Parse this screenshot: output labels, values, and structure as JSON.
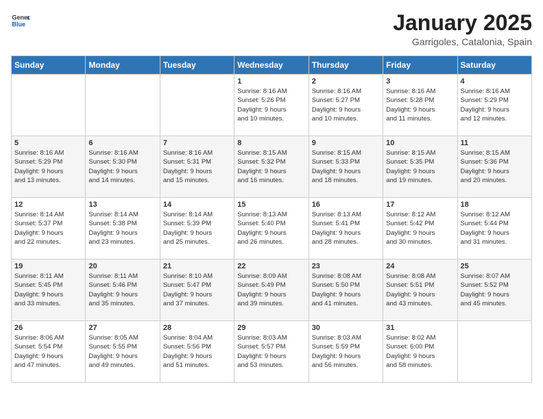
{
  "header": {
    "logo_general": "General",
    "logo_blue": "Blue",
    "month": "January 2025",
    "location": "Garrigoles, Catalonia, Spain"
  },
  "weekdays": [
    "Sunday",
    "Monday",
    "Tuesday",
    "Wednesday",
    "Thursday",
    "Friday",
    "Saturday"
  ],
  "weeks": [
    [
      {
        "day": "",
        "info": ""
      },
      {
        "day": "",
        "info": ""
      },
      {
        "day": "",
        "info": ""
      },
      {
        "day": "1",
        "info": "Sunrise: 8:16 AM\nSunset: 5:26 PM\nDaylight: 9 hours\nand 10 minutes."
      },
      {
        "day": "2",
        "info": "Sunrise: 8:16 AM\nSunset: 5:27 PM\nDaylight: 9 hours\nand 10 minutes."
      },
      {
        "day": "3",
        "info": "Sunrise: 8:16 AM\nSunset: 5:28 PM\nDaylight: 9 hours\nand 11 minutes."
      },
      {
        "day": "4",
        "info": "Sunrise: 8:16 AM\nSunset: 5:29 PM\nDaylight: 9 hours\nand 12 minutes."
      }
    ],
    [
      {
        "day": "5",
        "info": "Sunrise: 8:16 AM\nSunset: 5:29 PM\nDaylight: 9 hours\nand 13 minutes."
      },
      {
        "day": "6",
        "info": "Sunrise: 8:16 AM\nSunset: 5:30 PM\nDaylight: 9 hours\nand 14 minutes."
      },
      {
        "day": "7",
        "info": "Sunrise: 8:16 AM\nSunset: 5:31 PM\nDaylight: 9 hours\nand 15 minutes."
      },
      {
        "day": "8",
        "info": "Sunrise: 8:15 AM\nSunset: 5:32 PM\nDaylight: 9 hours\nand 16 minutes."
      },
      {
        "day": "9",
        "info": "Sunrise: 8:15 AM\nSunset: 5:33 PM\nDaylight: 9 hours\nand 18 minutes."
      },
      {
        "day": "10",
        "info": "Sunrise: 8:15 AM\nSunset: 5:35 PM\nDaylight: 9 hours\nand 19 minutes."
      },
      {
        "day": "11",
        "info": "Sunrise: 8:15 AM\nSunset: 5:36 PM\nDaylight: 9 hours\nand 20 minutes."
      }
    ],
    [
      {
        "day": "12",
        "info": "Sunrise: 8:14 AM\nSunset: 5:37 PM\nDaylight: 9 hours\nand 22 minutes."
      },
      {
        "day": "13",
        "info": "Sunrise: 8:14 AM\nSunset: 5:38 PM\nDaylight: 9 hours\nand 23 minutes."
      },
      {
        "day": "14",
        "info": "Sunrise: 8:14 AM\nSunset: 5:39 PM\nDaylight: 9 hours\nand 25 minutes."
      },
      {
        "day": "15",
        "info": "Sunrise: 8:13 AM\nSunset: 5:40 PM\nDaylight: 9 hours\nand 26 minutes."
      },
      {
        "day": "16",
        "info": "Sunrise: 8:13 AM\nSunset: 5:41 PM\nDaylight: 9 hours\nand 28 minutes."
      },
      {
        "day": "17",
        "info": "Sunrise: 8:12 AM\nSunset: 5:42 PM\nDaylight: 9 hours\nand 30 minutes."
      },
      {
        "day": "18",
        "info": "Sunrise: 8:12 AM\nSunset: 5:44 PM\nDaylight: 9 hours\nand 31 minutes."
      }
    ],
    [
      {
        "day": "19",
        "info": "Sunrise: 8:11 AM\nSunset: 5:45 PM\nDaylight: 9 hours\nand 33 minutes."
      },
      {
        "day": "20",
        "info": "Sunrise: 8:11 AM\nSunset: 5:46 PM\nDaylight: 9 hours\nand 35 minutes."
      },
      {
        "day": "21",
        "info": "Sunrise: 8:10 AM\nSunset: 5:47 PM\nDaylight: 9 hours\nand 37 minutes."
      },
      {
        "day": "22",
        "info": "Sunrise: 8:09 AM\nSunset: 5:49 PM\nDaylight: 9 hours\nand 39 minutes."
      },
      {
        "day": "23",
        "info": "Sunrise: 8:08 AM\nSunset: 5:50 PM\nDaylight: 9 hours\nand 41 minutes."
      },
      {
        "day": "24",
        "info": "Sunrise: 8:08 AM\nSunset: 5:51 PM\nDaylight: 9 hours\nand 43 minutes."
      },
      {
        "day": "25",
        "info": "Sunrise: 8:07 AM\nSunset: 5:52 PM\nDaylight: 9 hours\nand 45 minutes."
      }
    ],
    [
      {
        "day": "26",
        "info": "Sunrise: 8:06 AM\nSunset: 5:54 PM\nDaylight: 9 hours\nand 47 minutes."
      },
      {
        "day": "27",
        "info": "Sunrise: 8:05 AM\nSunset: 5:55 PM\nDaylight: 9 hours\nand 49 minutes."
      },
      {
        "day": "28",
        "info": "Sunrise: 8:04 AM\nSunset: 5:56 PM\nDaylight: 9 hours\nand 51 minutes."
      },
      {
        "day": "29",
        "info": "Sunrise: 8:03 AM\nSunset: 5:57 PM\nDaylight: 9 hours\nand 53 minutes."
      },
      {
        "day": "30",
        "info": "Sunrise: 8:03 AM\nSunset: 5:59 PM\nDaylight: 9 hours\nand 56 minutes."
      },
      {
        "day": "31",
        "info": "Sunrise: 8:02 AM\nSunset: 6:00 PM\nDaylight: 9 hours\nand 58 minutes."
      },
      {
        "day": "",
        "info": ""
      }
    ]
  ]
}
